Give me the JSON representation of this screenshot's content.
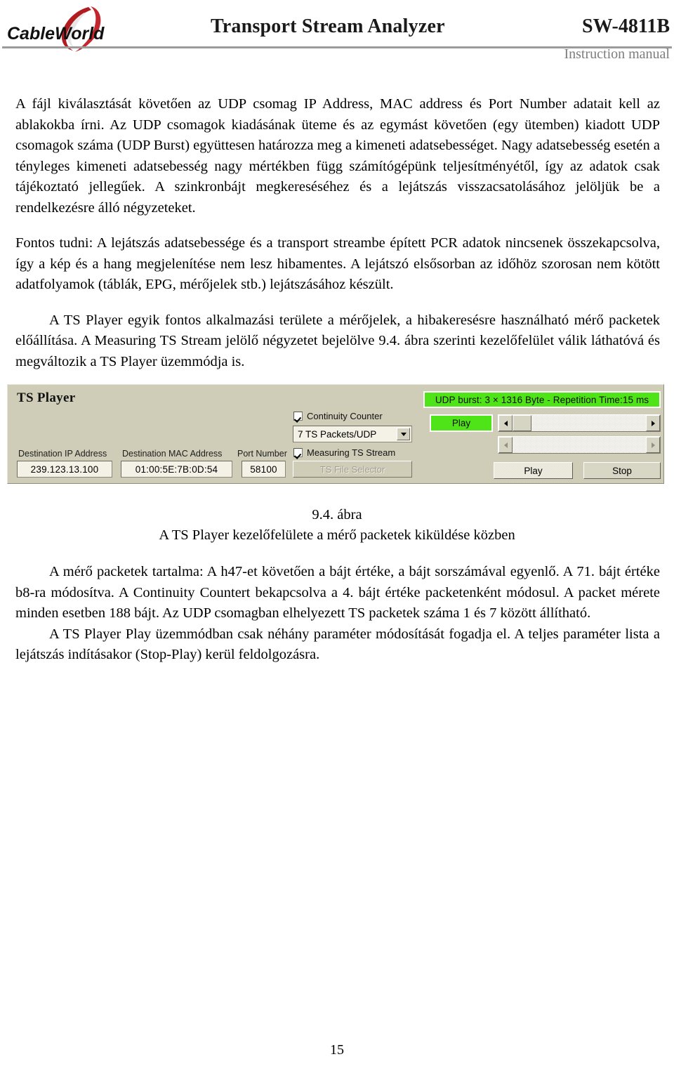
{
  "header": {
    "logo_text": "CableWorld",
    "title": "Transport Stream Analyzer",
    "model": "SW-4811B",
    "subtitle": "Instruction manual"
  },
  "body": {
    "p1": "A fájl kiválasztását követően az UDP csomag IP Address, MAC address és Port Number adatait kell az ablakokba írni. Az UDP csomagok kiadásának üteme és az egymást követően (egy ütemben) kiadott UDP csomagok száma (UDP Burst) együttesen határozza meg a kimeneti adatsebességet. Nagy adatsebesség esetén a tényleges kimeneti adatsebesség nagy mértékben függ számítógépünk teljesítményétől, így az adatok csak tájékoztató jellegűek. A szinkronbájt megkereséséhez és a lejátszás visszacsatolásához jelöljük be a rendelkezésre álló négyzeteket.",
    "p2": "Fontos tudni:  A lejátszás adatsebessége és a transport streambe épített PCR adatok nincsenek összekapcsolva, így a kép és a hang megjelenítése nem lesz hibamentes. A lejátszó elsősorban az időhöz szorosan nem kötött adatfolyamok (táblák, EPG, mérőjelek stb.) lejátszásához készült.",
    "p3": "A TS Player egyik fontos alkalmazási területe a mérőjelek, a hibakeresésre használható mérő packetek előállítása. A Measuring TS Stream jelölő négyzetet bejelölve 9.4. ábra szerinti kezelőfelület válik láthatóvá és megváltozik a TS Player üzemmódja is.",
    "p4": "A mérő packetek tartalma: A h47-et követően a bájt értéke, a bájt sorszámával egyenlő. A 71. bájt értéke b8-ra módosítva. A Continuity Countert bekapcsolva a 4. bájt értéke packetenként módosul. A packet mérete minden esetben 188 bájt. Az UDP csomagban elhelyezett TS packetek száma 1 és 7 között állítható.",
    "p5": "A TS Player Play üzemmódban csak néhány paraméter módosítását fogadja el. A teljes paraméter lista a lejátszás indításakor (Stop-Play) kerül feldolgozásra."
  },
  "figure": {
    "caption_line1": "9.4. ábra",
    "caption_line2": "A TS Player kezelőfelülete a mérő packetek kiküldése közben"
  },
  "ts_player": {
    "title": "TS Player",
    "colors": {
      "panel_bg": "#cfcdb8",
      "field_bg": "#f4f2e6",
      "green": "#4fe418"
    },
    "fields": [
      {
        "label": "Destination IP Address",
        "value": "239.123.13.100"
      },
      {
        "label": "Destination MAC Address",
        "value": "01:00:5E:7B:0D:54"
      },
      {
        "label": "Port Number",
        "value": "58100"
      }
    ],
    "continuity_counter": {
      "label": "Continuity Counter",
      "checked": true
    },
    "packets_combo": {
      "value": "7 TS Packets/UDP"
    },
    "measuring_stream": {
      "label": "Measuring TS Stream",
      "checked": true
    },
    "file_selector_button": {
      "label": "TS File Selector",
      "enabled": false
    },
    "status_bar": "UDP burst: 3 × 1316 Byte - Repetition Time:15 ms",
    "play_indicator": "Play",
    "play_button": "Play",
    "stop_button": "Stop"
  },
  "footer": {
    "page_number": "15"
  }
}
